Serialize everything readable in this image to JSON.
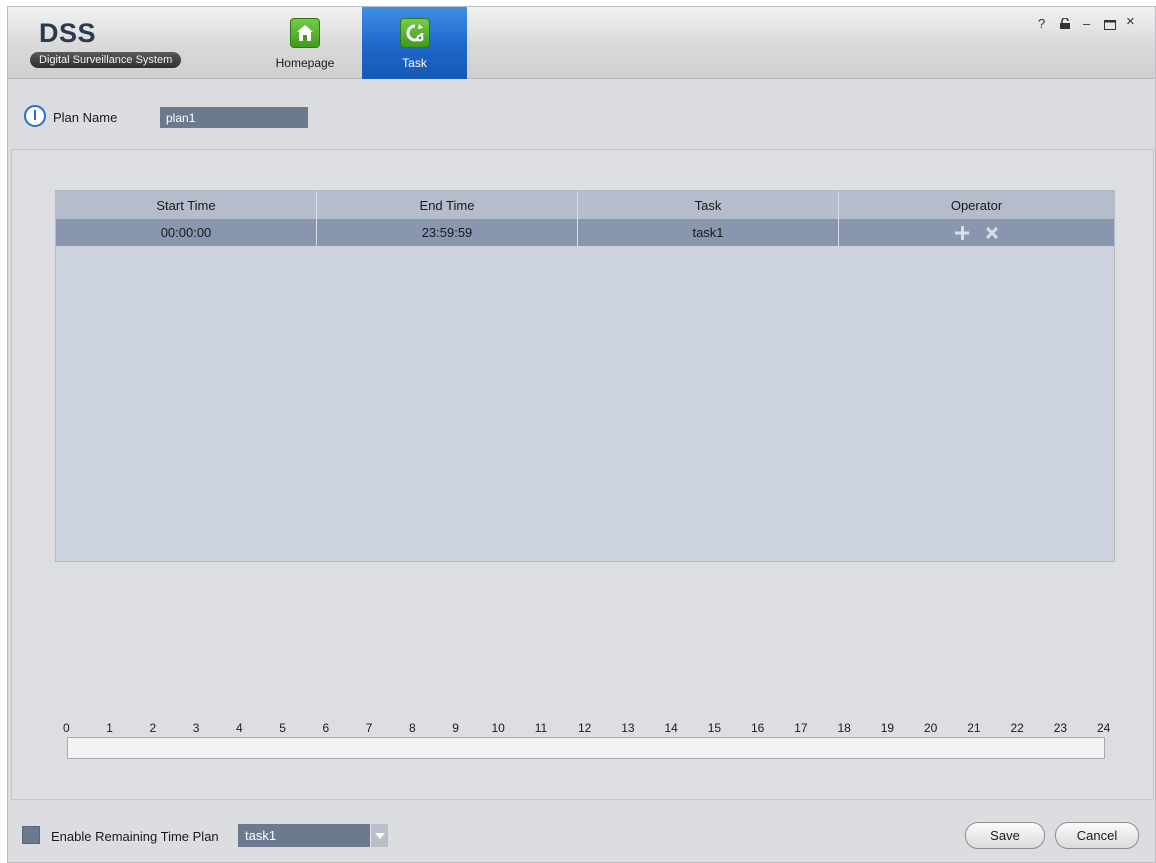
{
  "app": {
    "logo": "DSS",
    "subtitle": "Digital Surveillance System"
  },
  "tabs": [
    {
      "label": "Homepage",
      "icon": "home-icon",
      "active": false
    },
    {
      "label": "Task",
      "icon": "task-refresh-gear-icon",
      "active": true
    }
  ],
  "window_controls": {
    "help": "?",
    "lock": "lock-icon",
    "minimize": "–",
    "maximize": "maximize-icon",
    "close": "×"
  },
  "plan": {
    "label": "Plan Name",
    "value": "plan1"
  },
  "table": {
    "headers": [
      "Start Time",
      "End Time",
      "Task",
      "Operator"
    ],
    "rows": [
      {
        "start": "00:00:00",
        "end": "23:59:59",
        "task": "task1",
        "operators": [
          "add-icon",
          "delete-icon"
        ]
      }
    ]
  },
  "timeline": {
    "hours": [
      "0",
      "1",
      "2",
      "3",
      "4",
      "5",
      "6",
      "7",
      "8",
      "9",
      "10",
      "11",
      "12",
      "13",
      "14",
      "15",
      "16",
      "17",
      "18",
      "19",
      "20",
      "21",
      "22",
      "23",
      "24"
    ]
  },
  "footer": {
    "checkbox_label": "Enable Remaining Time Plan",
    "checkbox_checked": false,
    "select_value": "task1",
    "save": "Save",
    "cancel": "Cancel"
  },
  "colors": {
    "accent_tab": "#1d67c9",
    "input_bg": "#6b7a8f",
    "grid_header": "#b5bccb",
    "grid_selected_row": "#8996af",
    "grid_body": "#ccd3df"
  }
}
